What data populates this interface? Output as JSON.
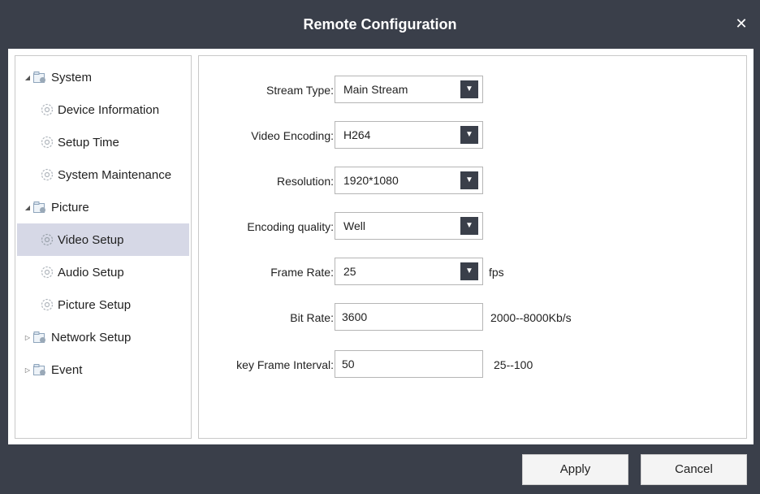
{
  "window": {
    "title": "Remote Configuration",
    "close_glyph": "✕"
  },
  "sidebar": {
    "items": [
      {
        "label": "System",
        "type": "group",
        "expanded": true,
        "icon": "folder-settings-icon"
      },
      {
        "label": "Device Information",
        "type": "child",
        "icon": "gear-icon"
      },
      {
        "label": "Setup Time",
        "type": "child",
        "icon": "gear-icon"
      },
      {
        "label": "System Maintenance",
        "type": "child",
        "icon": "gear-icon"
      },
      {
        "label": "Picture",
        "type": "group",
        "expanded": true,
        "icon": "folder-settings-icon"
      },
      {
        "label": "Video Setup",
        "type": "child",
        "icon": "gear-icon",
        "selected": true
      },
      {
        "label": "Audio Setup",
        "type": "child",
        "icon": "gear-icon"
      },
      {
        "label": "Picture Setup",
        "type": "child",
        "icon": "gear-icon"
      },
      {
        "label": "Network Setup",
        "type": "group",
        "expanded": false,
        "icon": "folder-settings-icon"
      },
      {
        "label": "Event",
        "type": "group",
        "expanded": false,
        "icon": "folder-settings-icon"
      }
    ]
  },
  "form": {
    "stream_type": {
      "label": "Stream Type:",
      "value": "Main Stream"
    },
    "video_encoding": {
      "label": "Video Encoding:",
      "value": "H264"
    },
    "resolution": {
      "label": "Resolution:",
      "value": "1920*1080"
    },
    "encoding_quality": {
      "label": "Encoding quality:",
      "value": "Well"
    },
    "frame_rate": {
      "label": "Frame Rate:",
      "value": "25",
      "unit": "fps"
    },
    "bit_rate": {
      "label": "Bit Rate:",
      "value": "3600",
      "unit": "2000--8000Kb/s"
    },
    "key_frame_interval": {
      "label": "key Frame Interval:",
      "value": "50",
      "unit": "25--100"
    }
  },
  "footer": {
    "apply_label": "Apply",
    "cancel_label": "Cancel"
  },
  "colors": {
    "chrome": "#3a3f4a",
    "selected": "#d6d8e6"
  }
}
